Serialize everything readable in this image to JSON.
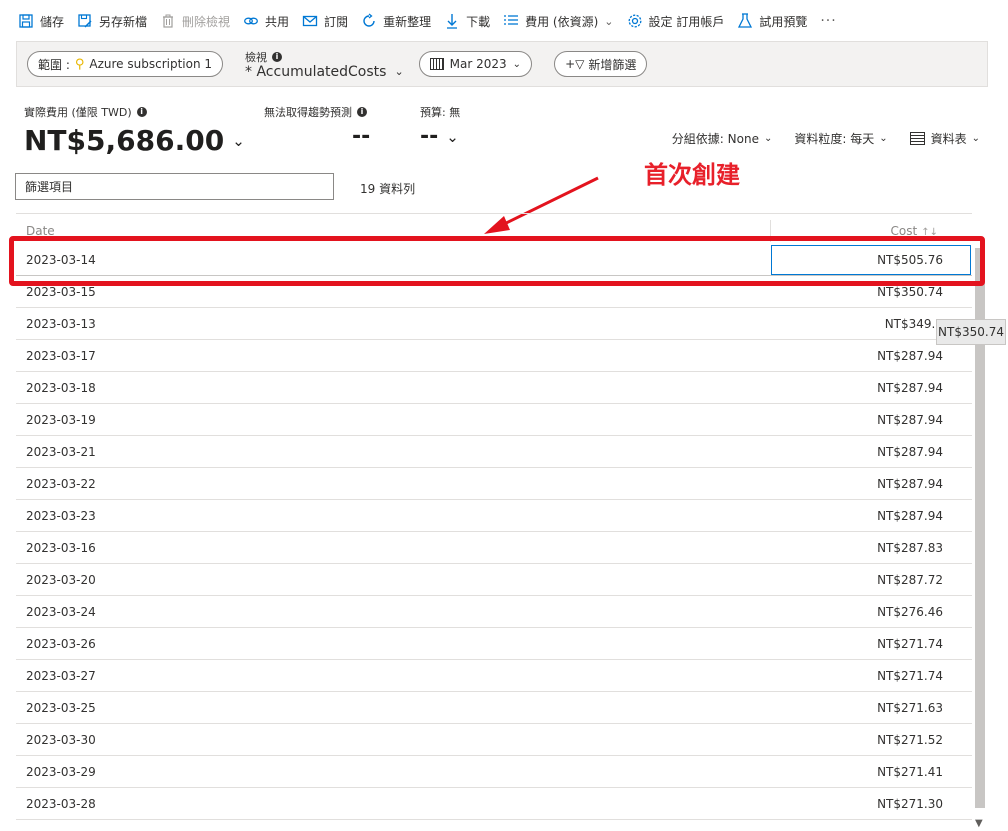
{
  "toolbar": {
    "save": "儲存",
    "save_as": "另存新檔",
    "delete_view": "刪除檢視",
    "share": "共用",
    "subscribe": "訂閱",
    "refresh": "重新整理",
    "download": "下載",
    "costs_by_resource": "費用 (依資源)",
    "settings": "設定 訂用帳戶",
    "try_preview": "試用預覽",
    "more": "···"
  },
  "filterbar": {
    "scope_label": "範圍 :",
    "scope_value": "Azure subscription 1",
    "view_label": "檢視",
    "view_name": "* AccumulatedCosts",
    "date_range": "Mar 2023",
    "add_filter": "新增篩選"
  },
  "summary": {
    "actual_cost_label": "實際費用 (僅限 TWD)",
    "actual_cost_value": "NT$5,686.00",
    "forecast_label": "無法取得趨勢預測",
    "forecast_value": "--",
    "budget_label": "預算: 無",
    "budget_value": "--"
  },
  "controls": {
    "group_by": "分組依據: None",
    "granularity": "資料粒度: 每天",
    "view_type": "資料表"
  },
  "filter": {
    "placeholder": "篩選項目",
    "row_count": "19 資料列"
  },
  "annotation": {
    "text": "首次創建"
  },
  "table": {
    "col_date": "Date",
    "col_cost": "Cost",
    "rows": [
      {
        "date": "2023-03-14",
        "cost": "NT$505.76"
      },
      {
        "date": "2023-03-15",
        "cost": "NT$350.74"
      },
      {
        "date": "2023-03-13",
        "cost": "NT$349.2"
      },
      {
        "date": "2023-03-17",
        "cost": "NT$287.94"
      },
      {
        "date": "2023-03-18",
        "cost": "NT$287.94"
      },
      {
        "date": "2023-03-19",
        "cost": "NT$287.94"
      },
      {
        "date": "2023-03-21",
        "cost": "NT$287.94"
      },
      {
        "date": "2023-03-22",
        "cost": "NT$287.94"
      },
      {
        "date": "2023-03-23",
        "cost": "NT$287.94"
      },
      {
        "date": "2023-03-16",
        "cost": "NT$287.83"
      },
      {
        "date": "2023-03-20",
        "cost": "NT$287.72"
      },
      {
        "date": "2023-03-24",
        "cost": "NT$276.46"
      },
      {
        "date": "2023-03-26",
        "cost": "NT$271.74"
      },
      {
        "date": "2023-03-27",
        "cost": "NT$271.74"
      },
      {
        "date": "2023-03-25",
        "cost": "NT$271.63"
      },
      {
        "date": "2023-03-30",
        "cost": "NT$271.52"
      },
      {
        "date": "2023-03-29",
        "cost": "NT$271.41"
      },
      {
        "date": "2023-03-28",
        "cost": "NT$271.30"
      }
    ]
  },
  "tooltip": {
    "text": "NT$350.74"
  },
  "colors": {
    "accent": "#0078d4",
    "annotation_red": "#e3131e",
    "text": "#323130"
  }
}
